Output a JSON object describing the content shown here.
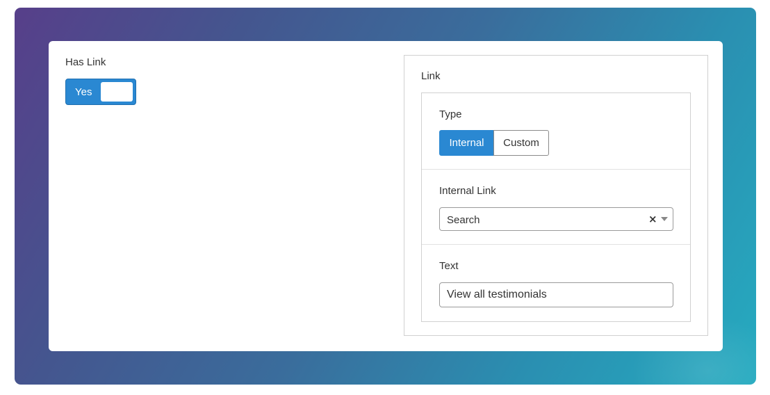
{
  "has_link": {
    "label": "Has Link",
    "toggle_label": "Yes",
    "value": true
  },
  "link": {
    "label": "Link",
    "type": {
      "label": "Type",
      "options": [
        "Internal",
        "Custom"
      ],
      "selected": "Internal"
    },
    "internal_link": {
      "label": "Internal Link",
      "value": "Search"
    },
    "text": {
      "label": "Text",
      "value": "View all testimonials"
    }
  },
  "colors": {
    "accent": "#2a88d2",
    "gradient_start": "#573f8a",
    "gradient_end": "#26abc0"
  },
  "icons": {
    "clear": "close-icon",
    "dropdown": "chevron-down-icon"
  }
}
